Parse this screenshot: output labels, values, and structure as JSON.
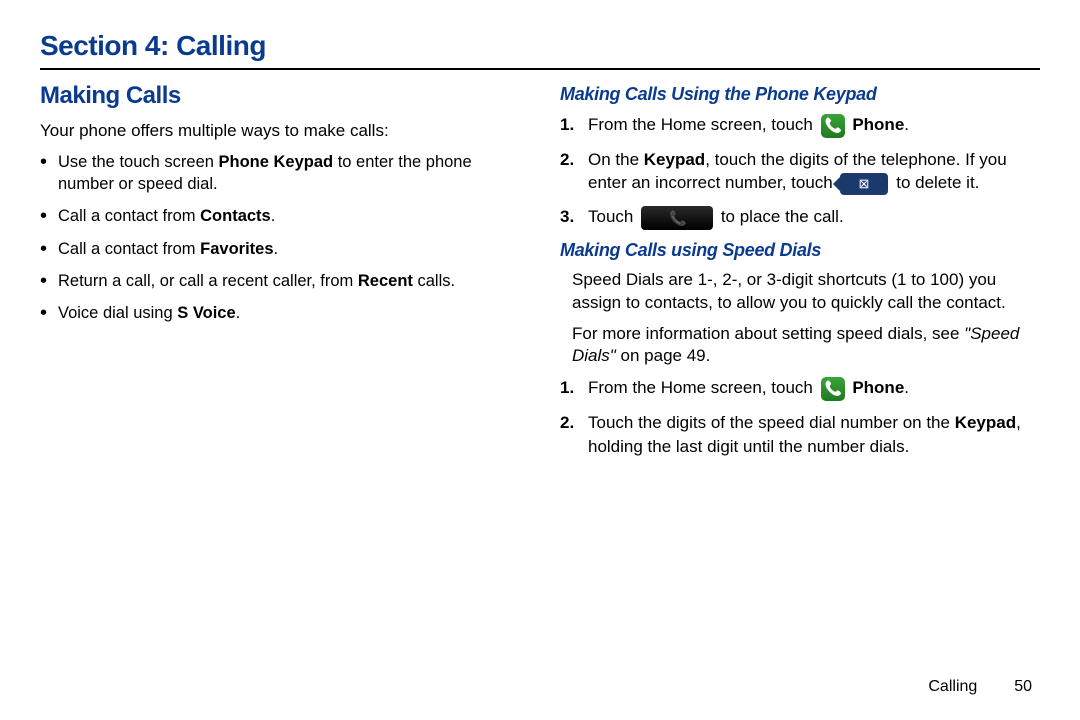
{
  "page_title": "Section 4: Calling",
  "left": {
    "heading": "Making Calls",
    "intro": "Your phone offers multiple ways to make calls:",
    "bullets": [
      {
        "pre": "Use the touch screen ",
        "bold": "Phone Keypad",
        "post": " to enter the phone number or speed dial."
      },
      {
        "pre": "Call a contact from ",
        "bold": "Contacts",
        "post": "."
      },
      {
        "pre": "Call a contact from ",
        "bold": "Favorites",
        "post": "."
      },
      {
        "pre": "Return a call, or call a recent caller, from ",
        "bold": "Recent",
        "post": " calls."
      },
      {
        "pre": "Voice dial using ",
        "bold": "S Voice",
        "post": "."
      }
    ]
  },
  "right": {
    "sub1": {
      "heading": "Making Calls Using the Phone Keypad",
      "steps": {
        "s1": {
          "num": "1.",
          "pre": "From the Home screen, touch ",
          "bold": "Phone",
          "post": "."
        },
        "s2": {
          "num": "2.",
          "part1": "On the ",
          "bold1": "Keypad",
          "part2": ", touch the digits of the telephone. If you enter an incorrect number, touch ",
          "part3": " to delete it."
        },
        "s3": {
          "num": "3.",
          "pre": "Touch ",
          "post": " to place the call."
        }
      }
    },
    "sub2": {
      "heading": "Making Calls using Speed Dials",
      "para1": "Speed Dials are 1-, 2-, or 3-digit shortcuts (1 to 100) you assign to contacts, to allow you to quickly call the contact.",
      "para2_pre": "For more information about setting speed dials, see ",
      "para2_italic": "\"Speed Dials\"",
      "para2_post": " on page 49.",
      "steps": {
        "s1": {
          "num": "1.",
          "pre": "From the Home screen, touch ",
          "bold": "Phone",
          "post": "."
        },
        "s2": {
          "num": "2.",
          "part1": "Touch the digits of the speed dial number on the ",
          "bold1": "Keypad",
          "part2": ", holding the last digit until the number dials."
        }
      }
    }
  },
  "footer": {
    "section": "Calling",
    "page": "50"
  }
}
